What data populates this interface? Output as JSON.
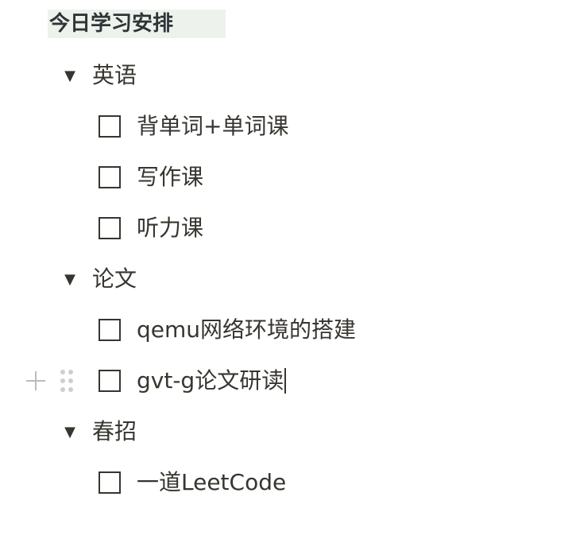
{
  "page": {
    "title": "今日学习安排"
  },
  "groups": [
    {
      "label": "英语",
      "toggle_icon": "▼",
      "tasks": [
        {
          "label": "背单词+单词课",
          "checked": false
        },
        {
          "label": "写作课",
          "checked": false
        },
        {
          "label": "听力课",
          "checked": false
        }
      ]
    },
    {
      "label": "论文",
      "toggle_icon": "▼",
      "tasks": [
        {
          "label": "qemu网络环境的搭建",
          "checked": false
        },
        {
          "label": "gvt-g论文研读",
          "checked": false
        }
      ]
    },
    {
      "label": "春招",
      "toggle_icon": "▼",
      "tasks": [
        {
          "label": "一道LeetCode",
          "checked": false
        }
      ]
    }
  ],
  "block_controls": {
    "add_icon": "plus-icon",
    "drag_icon": "drag-handle-icon"
  }
}
